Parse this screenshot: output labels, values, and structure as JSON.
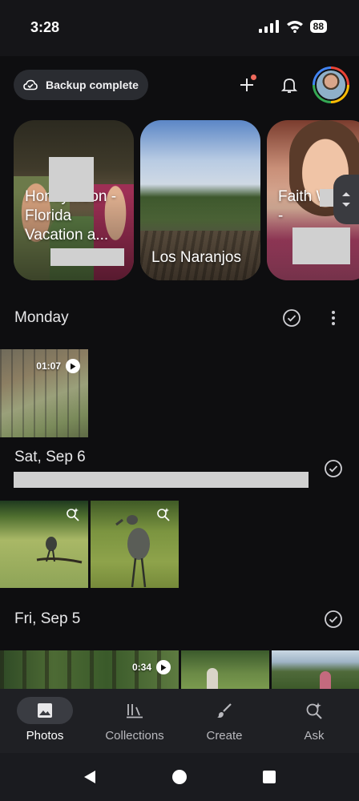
{
  "status": {
    "time": "3:28",
    "battery": "88"
  },
  "header": {
    "backup_label": "Backup complete"
  },
  "memories": [
    {
      "title": "Honeymoon - Florida Vacation a..."
    },
    {
      "title": "Los Naranjos"
    },
    {
      "title": "Faith White -"
    }
  ],
  "sections": [
    {
      "title": "Monday",
      "videos": [
        {
          "duration": "01:07"
        }
      ]
    },
    {
      "title": "Sat, Sep 6"
    },
    {
      "title": "Fri, Sep 5",
      "videos": [
        {
          "duration": "0:34"
        }
      ]
    }
  ],
  "nav": [
    {
      "label": "Photos",
      "icon": "photo-icon"
    },
    {
      "label": "Collections",
      "icon": "collections-icon"
    },
    {
      "label": "Create",
      "icon": "brush-icon"
    },
    {
      "label": "Ask",
      "icon": "ask-sparkle-icon"
    }
  ],
  "colors": {
    "background": "#0e0e10",
    "nav_bg": "#1f2024",
    "chip_bg": "#2a2c31",
    "notification_dot": "#ef6a5c"
  }
}
